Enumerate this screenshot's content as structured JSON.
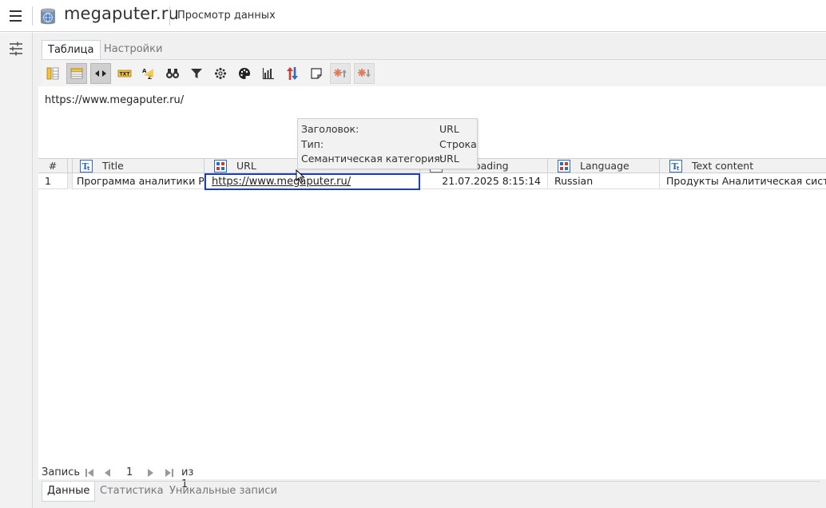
{
  "header": {
    "site_title": "megaputer.ru",
    "view_title": "Просмотр данных"
  },
  "tabs_top": [
    {
      "label": "Таблица",
      "active": true
    },
    {
      "label": "Настройки",
      "active": false
    }
  ],
  "toolbar": {
    "buttons": [
      "columns-icon",
      "row-header-icon",
      "fit-columns-icon",
      "text-icon",
      "sort-text-icon",
      "find-icon",
      "filter-icon",
      "cluster-icon",
      "palette-icon",
      "bar-chart-icon",
      "sort-icon",
      "note-icon",
      "mark-up-icon",
      "mark-down-icon"
    ]
  },
  "selected_value": "https://www.megaputer.ru/",
  "grid": {
    "headers": {
      "num": "#",
      "title": "Title",
      "url": "URL",
      "loading": "oading",
      "language": "Language",
      "text": "Text content"
    },
    "row": {
      "num": "1",
      "title": "Программа аналитики PolyAnalyst",
      "url": "https://www.megaputer.ru/",
      "loading": "21.07.2025 8:15:14",
      "language": "Russian",
      "text": "Продукты Аналитическая система PolyAnalyst"
    }
  },
  "tooltip": {
    "rows": [
      {
        "key": "Заголовок:",
        "value": "URL"
      },
      {
        "key": "Тип:",
        "value": "Строка"
      },
      {
        "key": "Семантическая категория:",
        "value": "URL"
      }
    ]
  },
  "pager": {
    "label": "Запись",
    "page": "1",
    "of": "из 1"
  },
  "tabs_bottom": [
    {
      "label": "Данные",
      "active": true
    },
    {
      "label": "Статистика",
      "active": false
    },
    {
      "label": "Уникальные записи",
      "active": false
    }
  ],
  "colors": {
    "selection_border": "#1a3fc4",
    "icon_blue": "#2b6cc4",
    "icon_red": "#d43a2f"
  }
}
